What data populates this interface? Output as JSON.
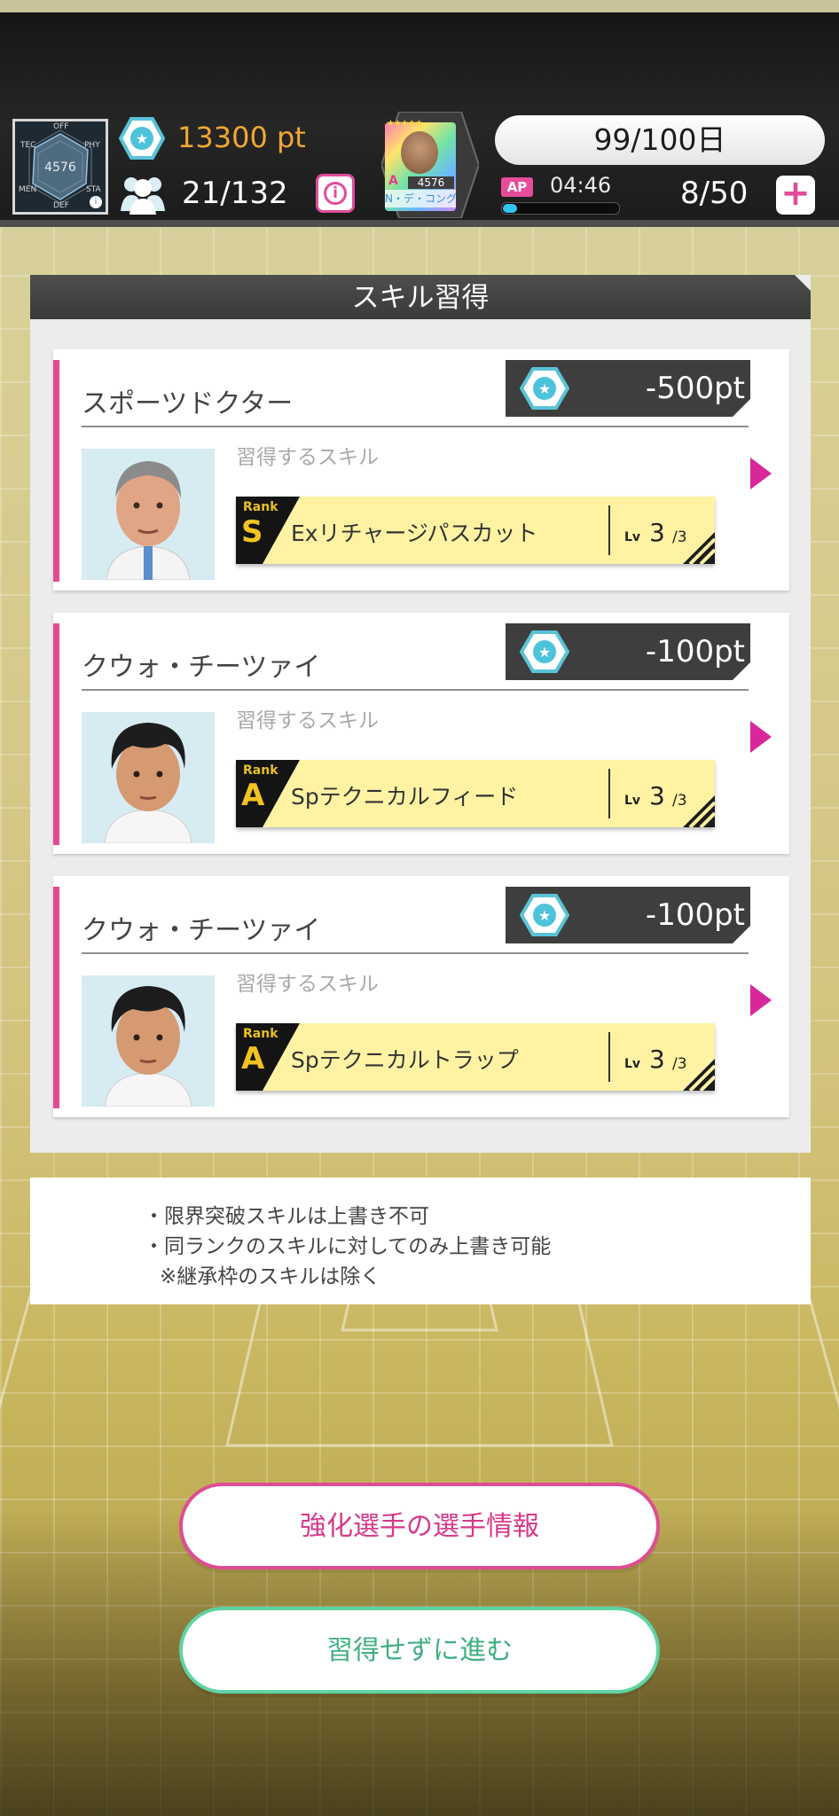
{
  "header": {
    "radar": {
      "labels": [
        "OFF",
        "PHY",
        "STA",
        "DEF",
        "MEN",
        "TEC"
      ],
      "value": "4576"
    },
    "points": "13300 pt",
    "members": "21/132",
    "info_symbol": "i",
    "card": {
      "rank": "A",
      "rating": "4576",
      "name": "N・デ・コング",
      "stars": "★★★★★"
    },
    "day_counter": "99/100日",
    "ap_badge": "AP",
    "ap_timer": "04:46",
    "ap_fill": 0.12,
    "ap_count": "8/50",
    "plus_symbol": "+"
  },
  "panel": {
    "title": "スキル習得"
  },
  "skill_cards": [
    {
      "name": "スポーツドクター",
      "cost": "-500pt",
      "learn_label": "習得するスキル",
      "rank_word": "Rank",
      "rank": "S",
      "skill": "Exリチャージパスカット",
      "lv_word": "Lv",
      "lv": "3",
      "lv_max": "/3"
    },
    {
      "name": "クウォ・チーツァイ",
      "cost": "-100pt",
      "learn_label": "習得するスキル",
      "rank_word": "Rank",
      "rank": "A",
      "skill": "Spテクニカルフィード",
      "lv_word": "Lv",
      "lv": "3",
      "lv_max": "/3"
    },
    {
      "name": "クウォ・チーツァイ",
      "cost": "-100pt",
      "learn_label": "習得するスキル",
      "rank_word": "Rank",
      "rank": "A",
      "skill": "Spテクニカルトラップ",
      "lv_word": "Lv",
      "lv": "3",
      "lv_max": "/3"
    }
  ],
  "notes": [
    "・限界突破スキルは上書き不可",
    "・同ランクのスキルに対してのみ上書き可能",
    "※継承枠のスキルは除く"
  ],
  "buttons": {
    "player_info": "強化選手の選手情報",
    "skip": "習得せずに進む"
  },
  "colors": {
    "accent_pink": "#e04c94",
    "accent_green": "#5fd3a4",
    "points_orange": "#f0a832",
    "skill_bar_yellow": "#fff3a3",
    "ap_cyan": "#31c4f0"
  },
  "icons": [
    "radar-chart-icon",
    "star-hexagon-icon",
    "members-icon",
    "info-icon",
    "plus-icon",
    "arrow-right-icon"
  ]
}
